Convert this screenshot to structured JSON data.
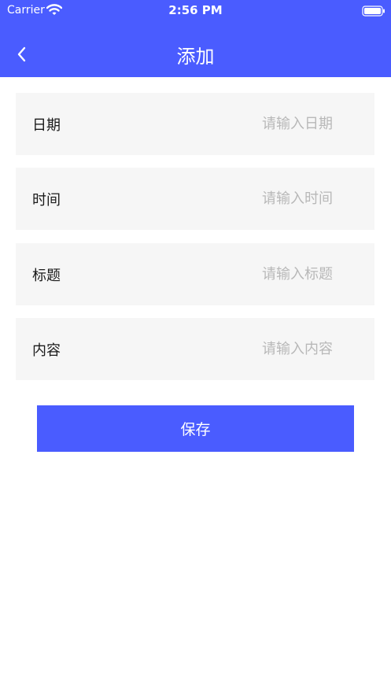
{
  "status_bar": {
    "carrier": "Carrier",
    "time": "2:56 PM"
  },
  "nav": {
    "title": "添加",
    "back_icon": "chevron-left-icon"
  },
  "form": {
    "rows": [
      {
        "label": "日期",
        "placeholder": "请输入日期",
        "value": ""
      },
      {
        "label": "时间",
        "placeholder": "请输入时间",
        "value": ""
      },
      {
        "label": "标题",
        "placeholder": "请输入标题",
        "value": ""
      },
      {
        "label": "内容",
        "placeholder": "请输入内容",
        "value": ""
      }
    ]
  },
  "save_button": {
    "label": "保存"
  },
  "colors": {
    "accent": "#4a5cff",
    "row_background": "#f6f6f6",
    "placeholder": "#b8b8b8",
    "label_text": "#1a1a1a"
  }
}
